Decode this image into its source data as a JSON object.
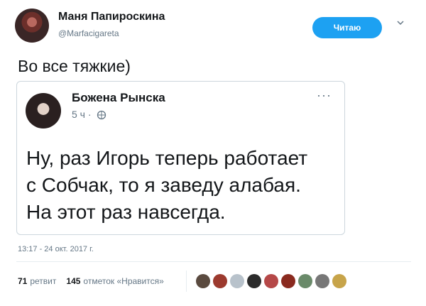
{
  "author": {
    "name": "Маня Папироскина",
    "handle": "@Marfacigareta"
  },
  "follow": {
    "label": "Читаю"
  },
  "tweet": {
    "text": "Во все тяжкие)"
  },
  "embedded_post": {
    "author": "Божена Рынска",
    "time": "5 ч ·",
    "text_lines": [
      "Ну, раз Игорь теперь работает",
      "с Собчак, то я заведу алабая.",
      "На этот раз навсегда."
    ]
  },
  "meta": {
    "date": "13:17 - 24 окт. 2017 г."
  },
  "stats": {
    "retweets_count": "71",
    "retweets_label": "ретвит",
    "likes_count": "145",
    "likes_label": "отметок «Нравится»"
  },
  "likers": [
    {
      "icon": "avatar-1",
      "color": "#5a4a3f"
    },
    {
      "icon": "avatar-2",
      "color": "#9c3a2e"
    },
    {
      "icon": "avatar-3",
      "color": "#b8c2cb"
    },
    {
      "icon": "avatar-4",
      "color": "#2b2b2b"
    },
    {
      "icon": "avatar-5",
      "color": "#b54848"
    },
    {
      "icon": "avatar-6",
      "color": "#8a2a1f"
    },
    {
      "icon": "avatar-7",
      "color": "#6a8a6a"
    },
    {
      "icon": "avatar-8",
      "color": "#777777"
    },
    {
      "icon": "avatar-9",
      "color": "#c7a44a"
    }
  ]
}
